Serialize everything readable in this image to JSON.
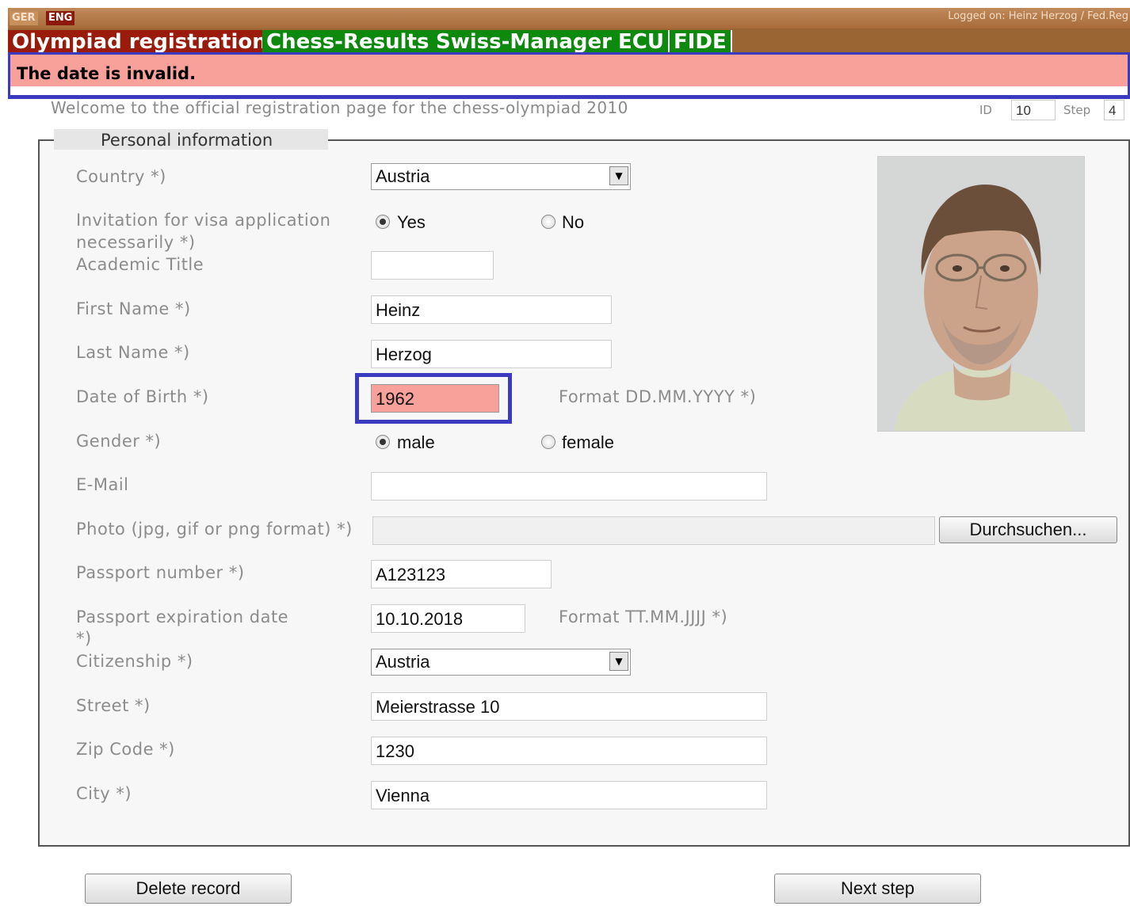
{
  "header": {
    "lang_ger": "GER",
    "lang_eng": "ENG",
    "logged_on": "Logged on: Heinz Herzog / Fed.Reg"
  },
  "nav": {
    "olympiad": "Olympiad registration",
    "chess_results": "Chess-Results",
    "swiss_manager": "Swiss-Manager",
    "ecu": "ECU",
    "fide": "FIDE"
  },
  "error": "The date is invalid.",
  "welcome": "Welcome to the official registration page for the chess-olympiad 2010",
  "meta": {
    "id_label": "ID",
    "id_value": "10",
    "step_label": "Step",
    "step_value": "4"
  },
  "section_title": "Personal information",
  "labels": {
    "country": "Country *)",
    "visa_1": "Invitation for visa application",
    "visa_2": "necessarily *)",
    "academic_title": "Academic Title",
    "first_name": "First Name *)",
    "last_name": "Last Name *)",
    "dob": "Date of Birth *)",
    "gender": "Gender *)",
    "email": "E-Mail",
    "photo": "Photo (jpg, gif or png format) *)",
    "passport_number": "Passport number *)",
    "passport_exp_1": "Passport expiration date",
    "passport_exp_2": "*)",
    "citizenship": "Citizenship *)",
    "street": "Street *)",
    "zip": "Zip Code *)",
    "city": "City *)"
  },
  "values": {
    "country": "Austria",
    "visa_yes": "Yes",
    "visa_no": "No",
    "visa_selected": "Yes",
    "academic_title": "",
    "first_name": "Heinz",
    "last_name": "Herzog",
    "dob": "1962",
    "dob_format": "Format DD.MM.YYYY *)",
    "gender_male": "male",
    "gender_female": "female",
    "gender_selected": "male",
    "email": "",
    "photo_path": "",
    "browse_button": "Durchsuchen...",
    "passport_number": "A123123",
    "passport_exp": "10.10.2018",
    "passport_exp_format": "Format TT.MM.JJJJ *)",
    "citizenship": "Austria",
    "street": "Meierstrasse 10",
    "zip": "1230",
    "city": "Vienna"
  },
  "buttons": {
    "delete": "Delete record",
    "next": "Next step"
  },
  "colors": {
    "error_bg": "#f8a09a",
    "highlight_border": "#3b3bbf",
    "nav_green": "#0d8a0d",
    "nav_red": "#9a1b0b",
    "header_brown": "#a86b3a"
  }
}
